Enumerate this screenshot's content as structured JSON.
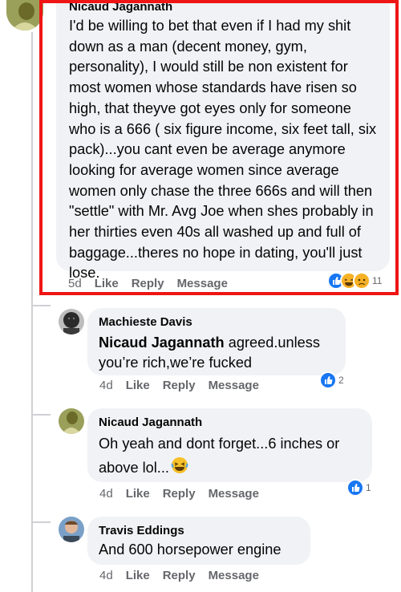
{
  "comments": [
    {
      "author": "Nicaud Jagannath",
      "text": "I'd be willing to bet that even if I had my shit down as a man (decent money, gym, personality), I would still be non existent for most women whose standards have risen so high, that theyve got eyes only for someone who is a 666 ( six figure income, six feet tall, six pack)...you cant even be average anymore looking for average women since average women only chase the three 666s and will then \"settle\" with Mr. Avg Joe when shes probably in her thirties even 40s all washed up and full of baggage...theres no hope in dating, you'll just lose.",
      "age": "5d",
      "like": "Like",
      "reply": "Reply",
      "message": "Message",
      "reaction_count": "11"
    },
    {
      "author": "Machieste Davis",
      "mention": "Nicaud Jagannath",
      "text": " agreed.unless you’re rich,we’re fucked",
      "age": "4d",
      "like": "Like",
      "reply": "Reply",
      "message": "Message",
      "reaction_count": "2"
    },
    {
      "author": "Nicaud Jagannath",
      "text": "Oh yeah and dont forget...6 inches or above lol...",
      "age": "4d",
      "like": "Like",
      "reply": "Reply",
      "message": "Message",
      "reaction_count": "1"
    },
    {
      "author": "Travis Eddings",
      "text": "And 600 horsepower engine",
      "age": "4d",
      "like": "Like",
      "reply": "Reply",
      "message": "Message"
    }
  ],
  "colors": {
    "highlight": "#ef1515",
    "like_blue": "#1877f2",
    "bubble": "#f0f2f5",
    "meta": "#65676b"
  },
  "icons": [
    "like-reaction-icon",
    "haha-reaction-icon",
    "sad-reaction-icon",
    "laughing-emoji-icon"
  ]
}
